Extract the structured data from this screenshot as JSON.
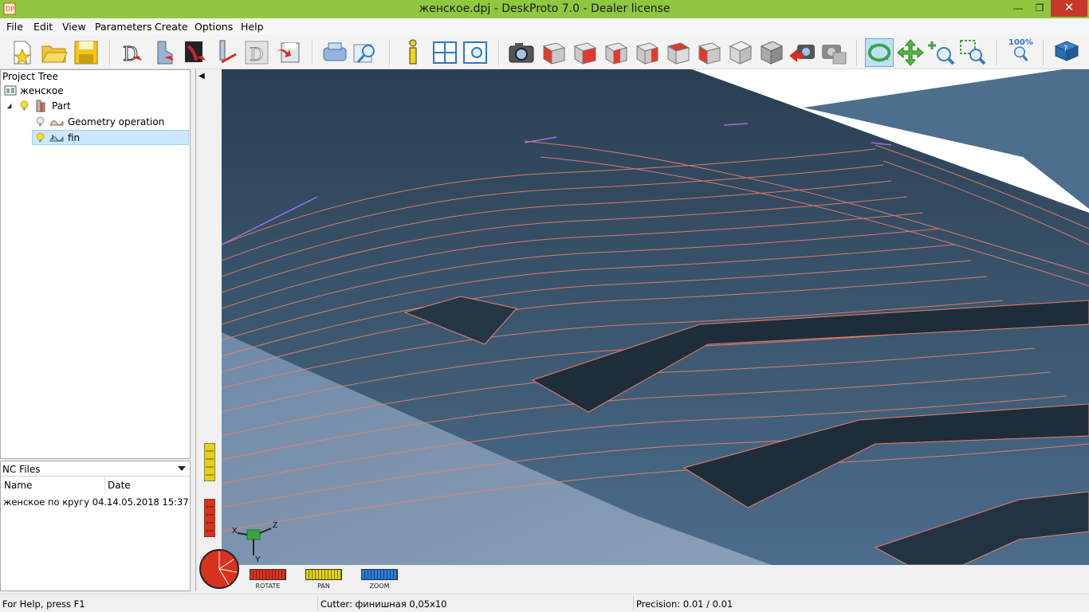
{
  "window": {
    "title": "женское.dpj - DeskProto 7.0 - Dealer license",
    "minimize_glyph": "—",
    "maximize_glyph": "❐",
    "close_glyph": "✕"
  },
  "menu": [
    "File",
    "Edit",
    "View",
    "Parameters",
    "Create",
    "Options",
    "Help"
  ],
  "toolbar": {
    "zoom_percent_label": "100%"
  },
  "project_tree": {
    "title": "Project Tree",
    "project_name": "женское",
    "part_label": "Part",
    "items": [
      {
        "label": "Geometry operation"
      },
      {
        "label": "fin",
        "selected": true
      }
    ]
  },
  "nc_files": {
    "title": "NC Files",
    "columns": [
      "Name",
      "Date"
    ],
    "rows": [
      {
        "name": "женское по кругу 04...",
        "date": "14.05.2018 15:37"
      }
    ]
  },
  "viewport": {
    "axes": {
      "x": "X",
      "y": "Y",
      "z": "Z"
    },
    "modes": [
      {
        "label": "ROTATE",
        "color": "#d9331f"
      },
      {
        "label": "PAN",
        "color": "#e3d21a"
      },
      {
        "label": "ZOOM",
        "color": "#2a7fd8"
      }
    ],
    "collapse_glyph": "◀"
  },
  "status": {
    "help": "For Help, press F1",
    "cutter": "Cutter: финишная 0,05x10",
    "precision": "Precision: 0.01 / 0.01"
  },
  "colors": {
    "titlebar": "#8fc83e",
    "toolpath": "#ee7f66",
    "surface": "#4a6a86",
    "close_button": "#c7382b"
  }
}
